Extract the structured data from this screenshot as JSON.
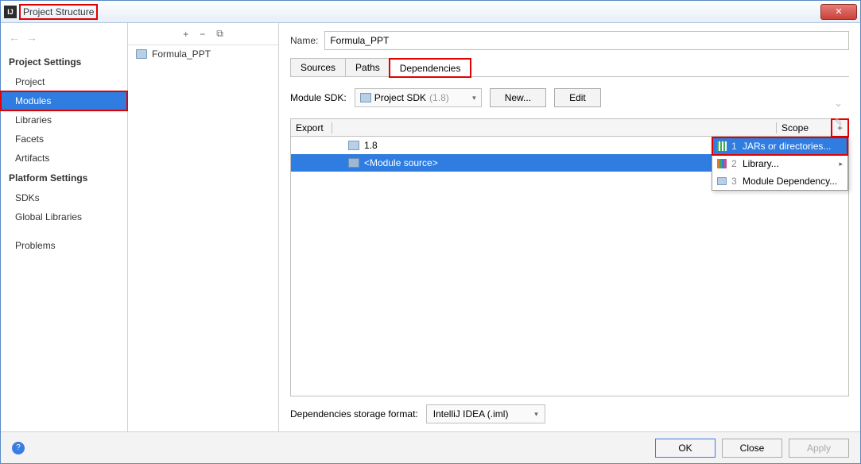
{
  "window": {
    "title": "Project Structure"
  },
  "nav": {
    "section1": "Project Settings",
    "items1": [
      "Project",
      "Modules",
      "Libraries",
      "Facets",
      "Artifacts"
    ],
    "section2": "Platform Settings",
    "items2": [
      "SDKs",
      "Global Libraries"
    ],
    "items3": [
      "Problems"
    ],
    "selected": "Modules"
  },
  "modules_panel": {
    "item": "Formula_PPT"
  },
  "detail": {
    "name_label": "Name:",
    "name_value": "Formula_PPT",
    "tabs": [
      "Sources",
      "Paths",
      "Dependencies"
    ],
    "active_tab": "Dependencies",
    "sdk_label": "Module SDK:",
    "sdk_value": "Project SDK",
    "sdk_version": "(1.8)",
    "new_btn": "New...",
    "edit_btn": "Edit",
    "table": {
      "col_export": "Export",
      "col_scope": "Scope",
      "rows": [
        {
          "label": "1.8",
          "selected": false
        },
        {
          "label": "<Module source>",
          "selected": true
        }
      ]
    },
    "add_menu": {
      "items": [
        {
          "n": "1",
          "label": "JARs or directories...",
          "selected": true
        },
        {
          "n": "2",
          "label": "Library...",
          "selected": false,
          "submenu": true
        },
        {
          "n": "3",
          "label": "Module Dependency...",
          "selected": false
        }
      ]
    },
    "storage_label": "Dependencies storage format:",
    "storage_value": "IntelliJ IDEA (.iml)"
  },
  "footer": {
    "ok": "OK",
    "cancel": "Close",
    "apply": "Apply"
  }
}
